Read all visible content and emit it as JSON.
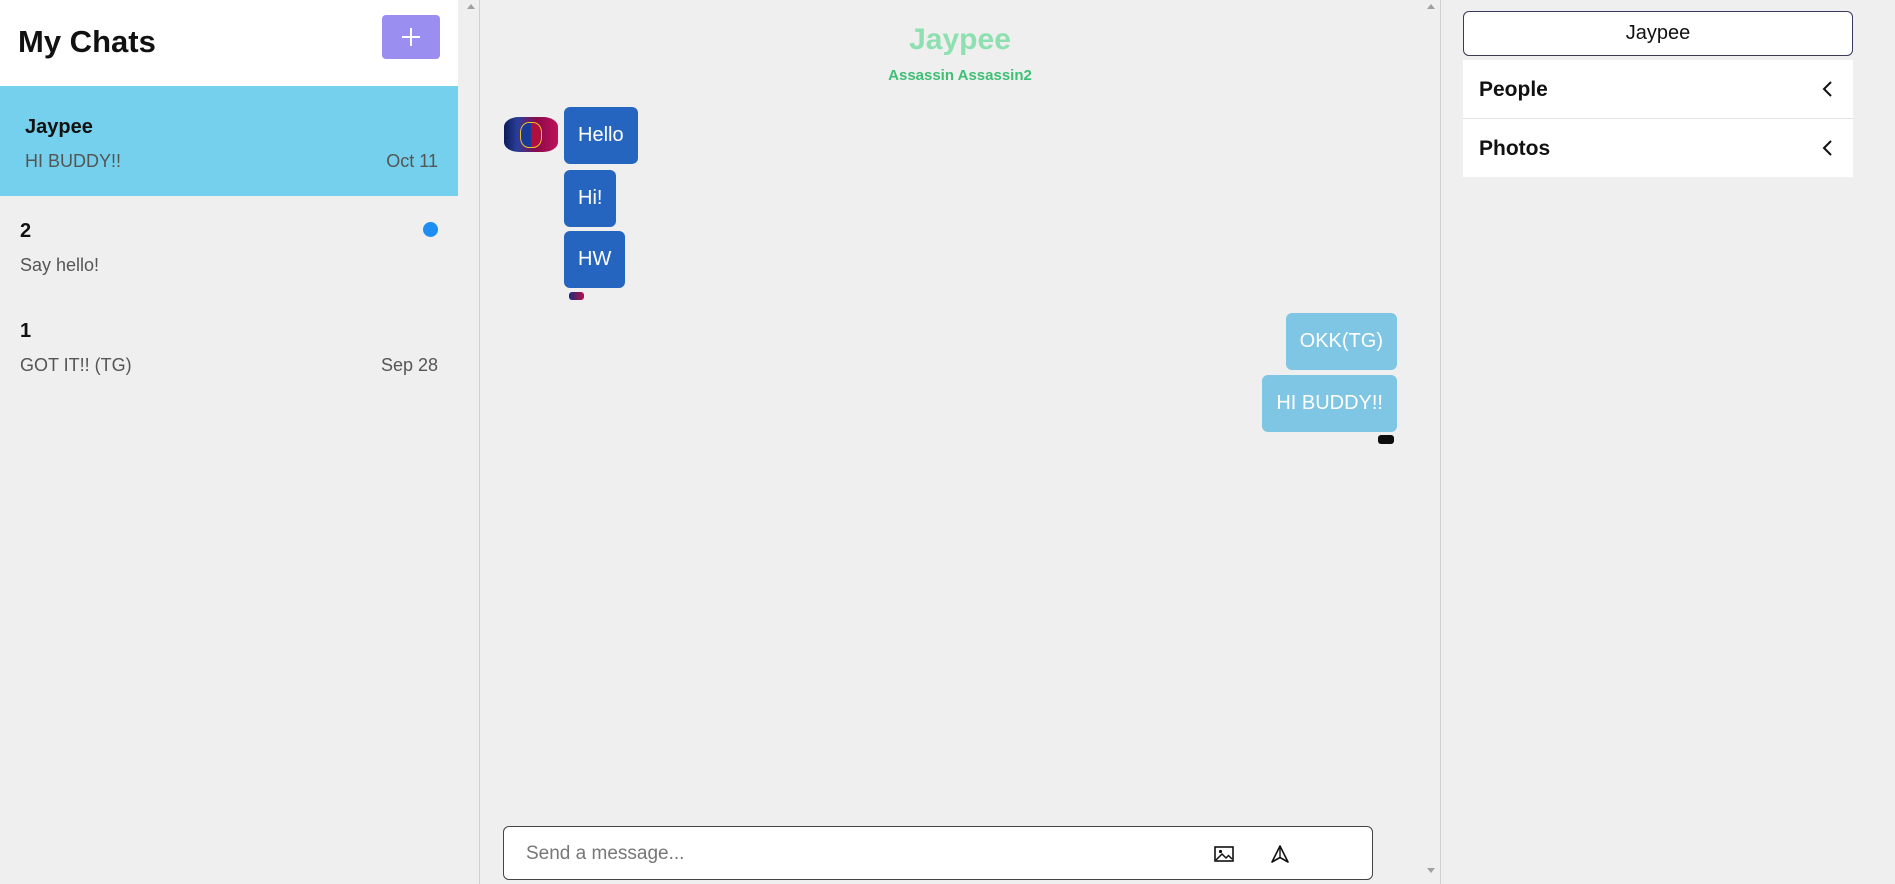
{
  "chat_list": {
    "title": "My Chats",
    "new_chat_label": "+",
    "chats": [
      {
        "title": "Jaypee",
        "preview": "HI BUDDY!!",
        "date": "Oct 11",
        "active": true,
        "unread": false
      },
      {
        "title": "2",
        "preview": "Say hello!",
        "date": "",
        "active": false,
        "unread": true
      },
      {
        "title": "1",
        "preview": "GOT IT!! (TG)",
        "date": "Sep 28",
        "active": false,
        "unread": false
      }
    ]
  },
  "feed": {
    "title": "Jaypee",
    "subtitle": "Assassin Assassin2",
    "messages": [
      {
        "text": "Hello",
        "sender": "other"
      },
      {
        "text": "Hi!",
        "sender": "other"
      },
      {
        "text": "HW",
        "sender": "other"
      },
      {
        "text": "OKK(TG)",
        "sender": "me"
      },
      {
        "text": "HI BUDDY!!",
        "sender": "me"
      }
    ],
    "input": {
      "placeholder": "Send a message..."
    },
    "icons": {
      "upload": "image-icon",
      "send": "send-icon"
    }
  },
  "settings": {
    "chat_title": "Jaypee",
    "sections": [
      {
        "label": "People",
        "icon": "chevron-left-icon"
      },
      {
        "label": "Photos",
        "icon": "chevron-left-icon"
      }
    ]
  },
  "colors": {
    "active_chat": "#74d0ec",
    "new_chat_button": "#9a8ef0",
    "unread_dot": "#1e8ef5",
    "their_message": "#2565bf",
    "my_message": "#7fc6e4",
    "feed_title": "#8ee0b0",
    "feed_subtitle": "#3fbf76"
  }
}
